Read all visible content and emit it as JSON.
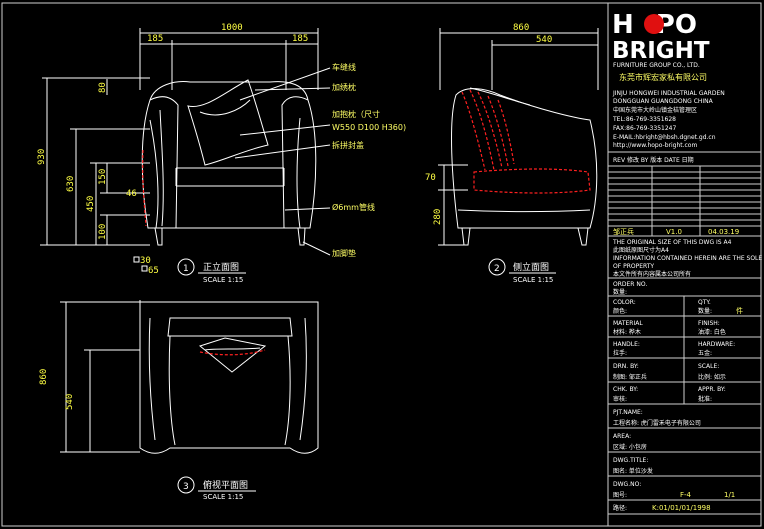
{
  "front_view": {
    "width_total": "1000",
    "arm_left": "185",
    "arm_right": "185",
    "height_total": "930",
    "h_630": "630",
    "h_450": "450",
    "h_150": "150",
    "h_100": "100",
    "h_80": "80",
    "h_46": "46",
    "foot_30": "30",
    "foot_65": "65",
    "num": "1",
    "title": "正立面图",
    "scale": "SCALE 1:15"
  },
  "annotations": {
    "a1": "车缝线",
    "a2": "加绣枕",
    "a3": "加抱枕（尺寸",
    "a4": "W550 D100 H360)",
    "a5": "拆拼封盖",
    "a6": "Ø6mm管线",
    "a7": "加脚垫"
  },
  "side_view": {
    "width_total": "860",
    "width_seat": "540",
    "h_70": "70",
    "h_280": "280",
    "num": "2",
    "title": "侧立面图",
    "scale": "SCALE 1:15"
  },
  "top_view": {
    "depth_total": "860",
    "depth_seat": "540",
    "num": "3",
    "title": "俯视平面图",
    "scale": "SCALE 1:15"
  },
  "title_block": {
    "logo_line1": "HOPO",
    "logo_line2": "BRIGHT",
    "company_en": "FURNITURE GROUP CO., LTD.",
    "company_cn": "东莞市辉宏家私有限公司",
    "addr1": "JINJU HONGWEI INDUSTRIAL GARDEN",
    "addr2": "DONGGUAN GUANGDONG CHINA",
    "addr3": "中国东莞市大岭山镇金桔管理区",
    "tel": "TEL:86-769-3351628",
    "fax": "FAX:86-769-3351247",
    "email": "E-MAIL:hbright@hbsh.dgnet.gd.cn",
    "web": "http://www.hopo-bright.com",
    "rev_header": "REV 修改  BY 版本  DATE 日期",
    "designer": "邹正兵",
    "version": "V1.0",
    "date": "04.03.19",
    "note1": "THE ORIGINAL SIZE OF THIS DWG IS A4",
    "note2": "此图纸原图尺寸为A4",
    "note3": "INFORMATION CONTAINED HEREIN ARE THE SOLE",
    "note4": "OF PROPERTY",
    "note5": "本文件所有内容属本公司所有",
    "order_no": "ORDER NO.",
    "qty_label": "数量:",
    "color_label": "COLOR:",
    "qty2_label": "QTY.",
    "color_cn": "颜色:",
    "qty2_cn": "数量:",
    "unit": "件",
    "material_label": "MATERIAL",
    "finish_label": "FINISH:",
    "material_cn": "材料: 桦木",
    "finish_cn": "油漆: 白色",
    "handle_label": "HANDLE:",
    "hardware_label": "HARDWARE:",
    "handle_cn": "拉手:",
    "hardware_cn": "五金:",
    "drn_label": "DRN. BY:",
    "scale_label": "SCALE:",
    "drn_cn": "制图: 邹正兵",
    "scale_cn": "比例: 如示",
    "chk_label": "CHK. BY:",
    "appr_label": "APPR. BY:",
    "chk_cn": "审核:",
    "appr_cn": "批准:",
    "prj_label": "PJT.NAME:",
    "prj_cn": "工程名称: 虎门雷禾电子有限公司",
    "area_label": "AREA:",
    "area_cn": "区域: 小包房",
    "dwg_title_label": "DWG.TITLE:",
    "dwg_title_cn": "图名: 单位沙发",
    "dwg_no_label": "DWG.NO:",
    "dwg_no_cn": "图号:",
    "dwg_no_val": "F-4",
    "sheet": "1/1",
    "path_label": "路径:",
    "path_val": "K:01/01/01/1998"
  }
}
